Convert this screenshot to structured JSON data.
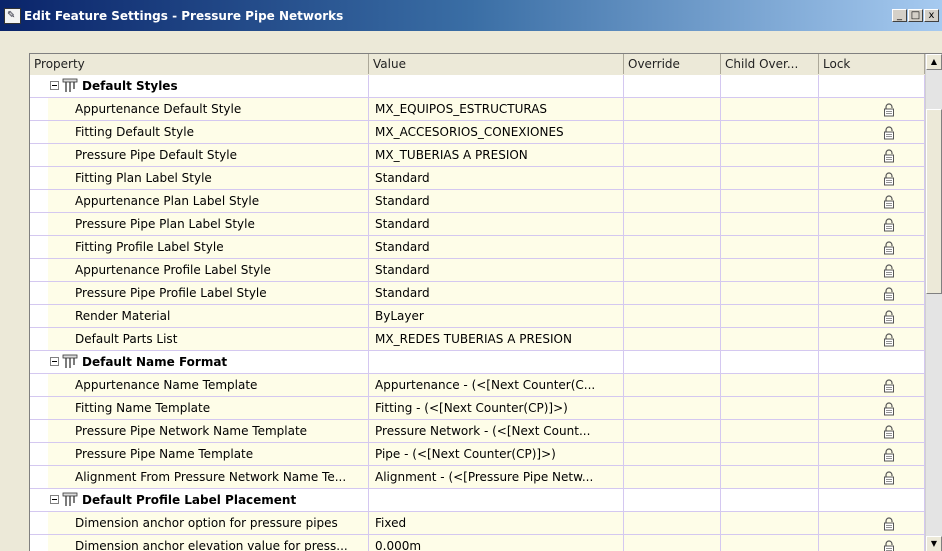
{
  "window": {
    "title": "Edit Feature Settings - Pressure Pipe Networks",
    "app_icon": "autocad-civil-icon",
    "buttons": {
      "minimize": "_",
      "maximize": "□",
      "close": "x"
    }
  },
  "columns": [
    "Property",
    "Value",
    "Override",
    "Child Over...",
    "Lock"
  ],
  "rows": [
    {
      "type": "section",
      "label": "Default Styles"
    },
    {
      "type": "item",
      "property": "Appurtenance Default Style",
      "value": "MX_EQUIPOS_ESTRUCTURAS",
      "locked": false
    },
    {
      "type": "item",
      "property": "Fitting Default Style",
      "value": "MX_ACCESORIOS_CONEXIONES",
      "locked": false
    },
    {
      "type": "item",
      "property": "Pressure Pipe Default Style",
      "value": "MX_TUBERIAS A PRESION",
      "locked": false
    },
    {
      "type": "item",
      "property": "Fitting Plan Label Style",
      "value": "Standard",
      "locked": false
    },
    {
      "type": "item",
      "property": "Appurtenance Plan Label Style",
      "value": "Standard",
      "locked": false
    },
    {
      "type": "item",
      "property": "Pressure Pipe Plan Label Style",
      "value": "Standard",
      "locked": false
    },
    {
      "type": "item",
      "property": "Fitting Profile Label Style",
      "value": "Standard",
      "locked": false
    },
    {
      "type": "item",
      "property": "Appurtenance Profile Label Style",
      "value": "Standard",
      "locked": false
    },
    {
      "type": "item",
      "property": "Pressure Pipe Profile Label Style",
      "value": "Standard",
      "locked": false
    },
    {
      "type": "item",
      "property": "Render Material",
      "value": "ByLayer",
      "locked": false
    },
    {
      "type": "item",
      "property": "Default Parts List",
      "value": "MX_REDES TUBERIAS A PRESION",
      "locked": false
    },
    {
      "type": "section",
      "label": "Default Name Format"
    },
    {
      "type": "item",
      "property": "Appurtenance Name Template",
      "value": "Appurtenance - (<[Next Counter(C...",
      "locked": false
    },
    {
      "type": "item",
      "property": "Fitting Name Template",
      "value": "Fitting - (<[Next Counter(CP)]>)",
      "locked": false
    },
    {
      "type": "item",
      "property": "Pressure Pipe Network Name Template",
      "value": "Pressure Network - (<[Next Count...",
      "locked": false
    },
    {
      "type": "item",
      "property": "Pressure Pipe Name Template",
      "value": "Pipe - (<[Next Counter(CP)]>)",
      "locked": false
    },
    {
      "type": "item",
      "property": "Alignment From Pressure Network Name Te...",
      "value": "Alignment - (<[Pressure Pipe Netw...",
      "locked": false
    },
    {
      "type": "section",
      "label": "Default Profile Label Placement"
    },
    {
      "type": "item",
      "property": "Dimension anchor option for pressure pipes",
      "value": "Fixed",
      "locked": false
    },
    {
      "type": "item",
      "property": "Dimension anchor elevation value for press...",
      "value": "0.000m",
      "locked": false
    }
  ],
  "icons": {
    "expander": "collapse-minus-icon",
    "section": "pressure-pipe-icon",
    "lock": "padlock-open-icon"
  },
  "colors": {
    "title_gradient_start": "#0a246a",
    "row_background": "#fefde8",
    "grid_line": "#d4c8f0"
  }
}
